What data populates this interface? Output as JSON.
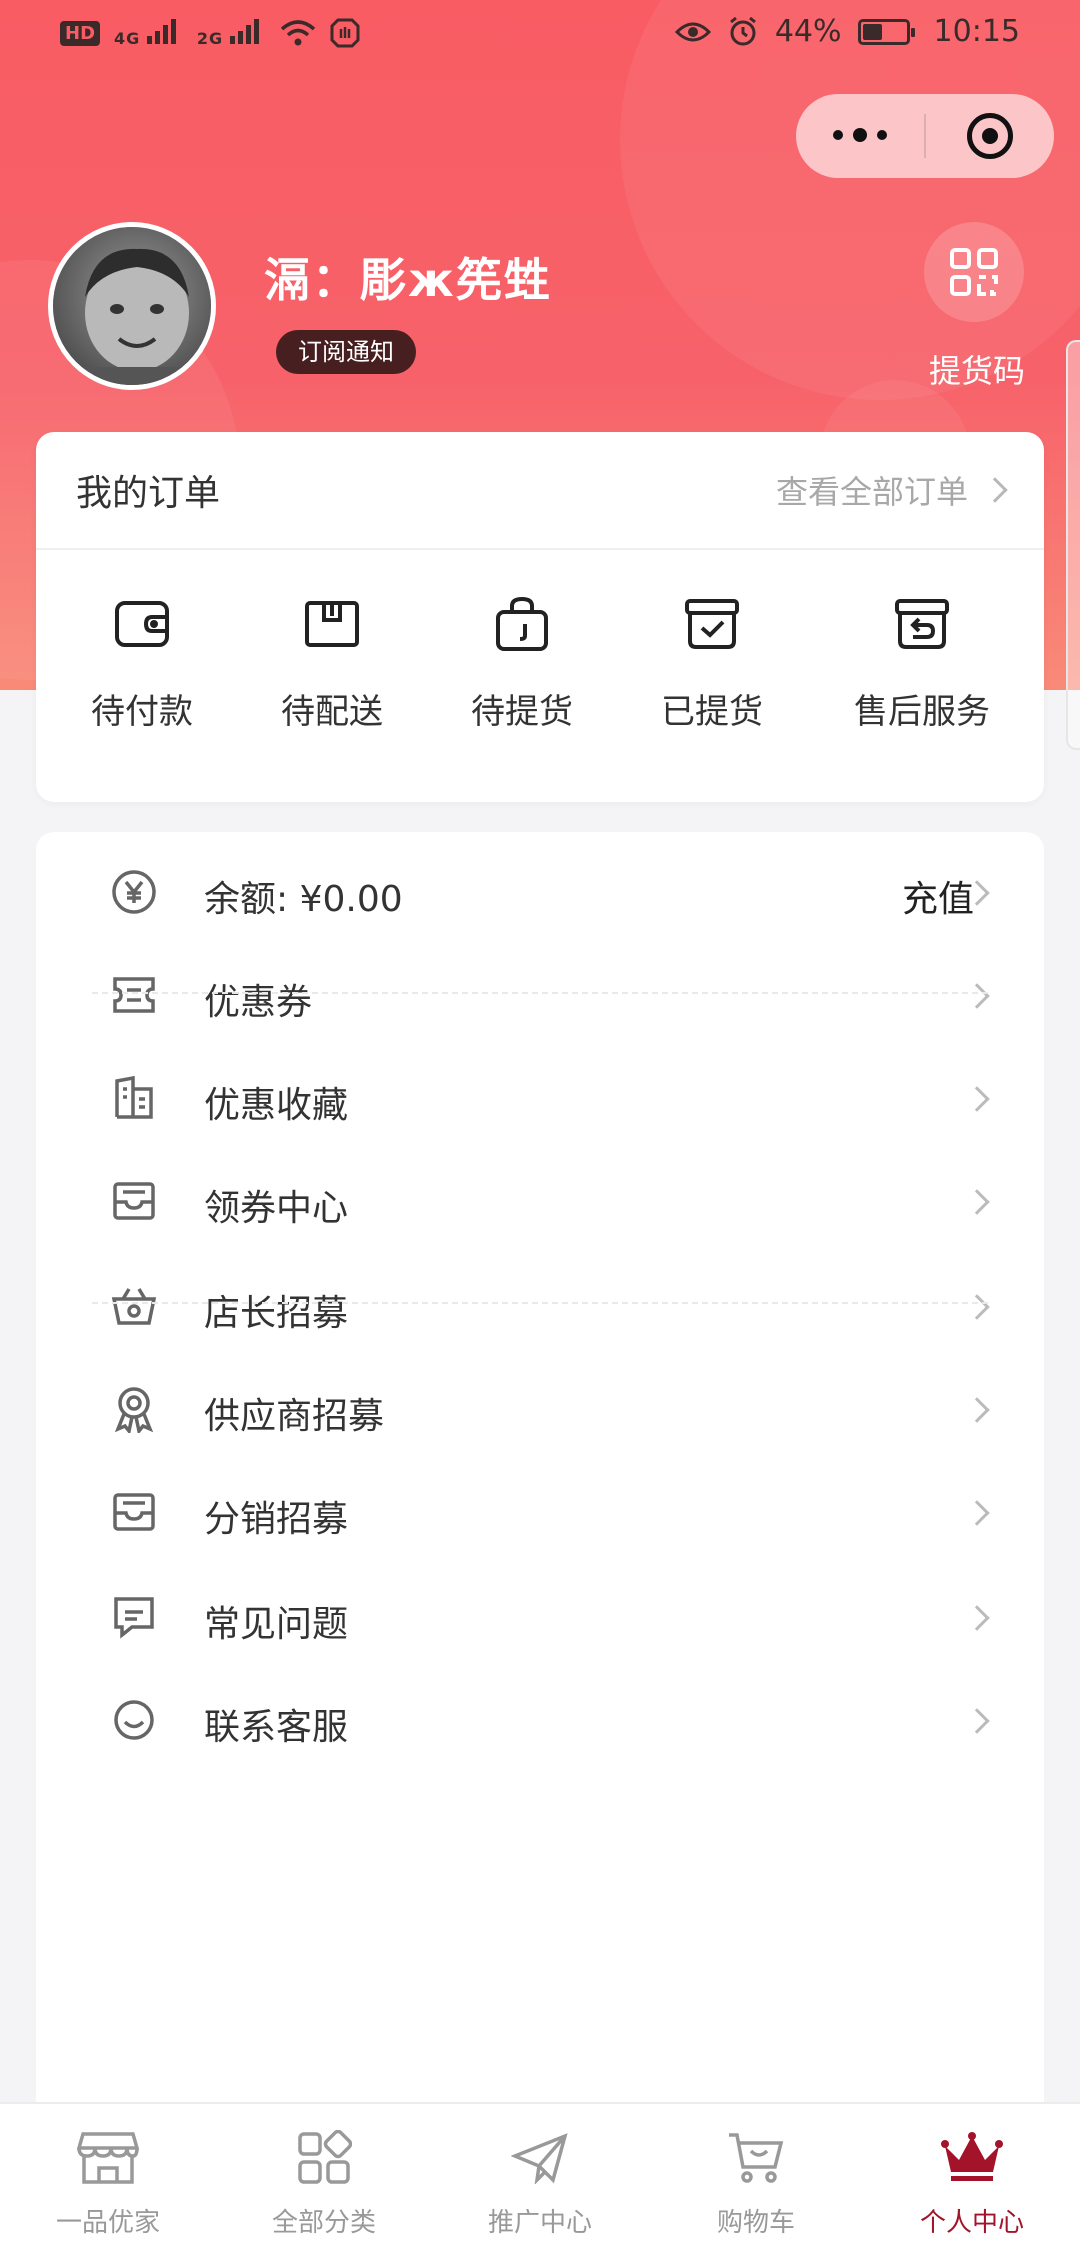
{
  "status_bar": {
    "hd": "HD",
    "signal1": "4G",
    "signal2": "2G",
    "battery_pct": "44%",
    "battery_level": 0.44,
    "time": "10:15"
  },
  "colors": {
    "brand": "#f95c63",
    "active_tab": "#a3142a",
    "text": "#333333",
    "muted": "#a8a8a8"
  },
  "profile": {
    "name": "滆：彫ж筅甡",
    "subscribe_label": "订阅通知",
    "pickup_code_label": "提货码"
  },
  "orders": {
    "title": "我的订单",
    "view_all": "查看全部订单",
    "items": [
      {
        "label": "待付款",
        "icon": "wallet-icon"
      },
      {
        "label": "待配送",
        "icon": "package-icon"
      },
      {
        "label": "待提货",
        "icon": "shopping-bag-icon"
      },
      {
        "label": "已提货",
        "icon": "box-check-icon"
      },
      {
        "label": "售后服务",
        "icon": "box-return-icon"
      }
    ]
  },
  "menu": {
    "balance_label": "余额: ¥0.00",
    "recharge_label": "充值",
    "items": [
      {
        "label": "优惠券",
        "icon": "coupon-icon"
      },
      {
        "label": "优惠收藏",
        "icon": "building-icon"
      },
      {
        "label": "领券中心",
        "icon": "inbox-icon"
      },
      {
        "label": "店长招募",
        "icon": "basket-icon"
      },
      {
        "label": "供应商招募",
        "icon": "medal-icon"
      },
      {
        "label": "分销招募",
        "icon": "inbox-icon"
      },
      {
        "label": "常见问题",
        "icon": "message-icon"
      },
      {
        "label": "联系客服",
        "icon": "smile-icon"
      }
    ]
  },
  "tabbar": {
    "items": [
      {
        "label": "一品优家",
        "icon": "store-icon"
      },
      {
        "label": "全部分类",
        "icon": "categories-icon"
      },
      {
        "label": "推广中心",
        "icon": "paper-plane-icon"
      },
      {
        "label": "购物车",
        "icon": "cart-icon"
      },
      {
        "label": "个人中心",
        "icon": "crown-icon"
      }
    ],
    "active_index": 4
  }
}
